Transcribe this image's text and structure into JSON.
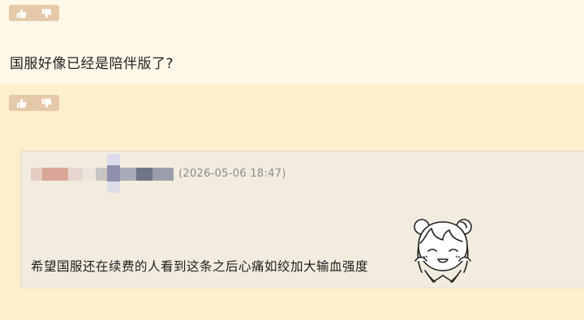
{
  "post": {
    "text": "国服好像已经是陪伴版了?"
  },
  "reply": {
    "timestamp": "(2026-05-06 18:47)",
    "quote_text": "希望国服还在续费的人看到这条之后心痛如绞加大输血强度"
  },
  "icons": {
    "like": "thumbs-up-icon",
    "dislike": "thumbs-down-icon",
    "sticker": "anime-girl-sticker"
  },
  "colors": {
    "page_bg": "#fff8e9",
    "reply_bg": "#fdefcc",
    "quote_bg": "#f2ecdf",
    "vote_bg": "#e6c9a8",
    "timestamp": "#8a8a8a"
  }
}
